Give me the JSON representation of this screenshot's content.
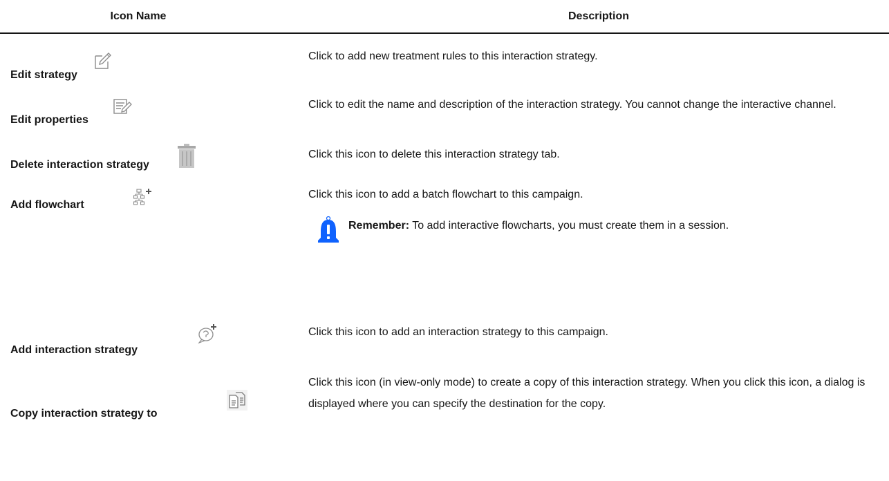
{
  "header": {
    "icon_name": "Icon Name",
    "description": "Description"
  },
  "rows": [
    {
      "name": "Edit strategy",
      "icon": "edit-pencil-icon",
      "description": "Click to add new treatment rules to this interaction strategy."
    },
    {
      "name": "Edit properties",
      "icon": "edit-properties-icon",
      "description": "Click to edit the name and description of the interaction strategy. You cannot change the interactive channel."
    },
    {
      "name": "Delete interaction strategy",
      "icon": "trash-icon",
      "description": "Click this icon to delete this interaction strategy tab."
    },
    {
      "name": "Add flowchart",
      "icon": "add-flowchart-icon",
      "description": "Click this icon to add a batch flowchart to this campaign.",
      "note": {
        "label": "Remember:",
        "text": " To add interactive flowcharts, you must create them in a session."
      }
    },
    {
      "name": "Add interaction strategy",
      "icon": "add-strategy-icon",
      "description": "Click this icon to add an interaction strategy to this campaign."
    },
    {
      "name": "Copy interaction strategy to",
      "icon": "copy-document-icon",
      "description": "Click this icon (in view-only mode) to create a copy of this interaction strategy. When you click this icon, a dialog is displayed where you can specify the destination for the copy."
    }
  ],
  "colors": {
    "text": "#161616",
    "icon_gray": "#8c8c8c",
    "note_blue": "#0f62fe"
  }
}
